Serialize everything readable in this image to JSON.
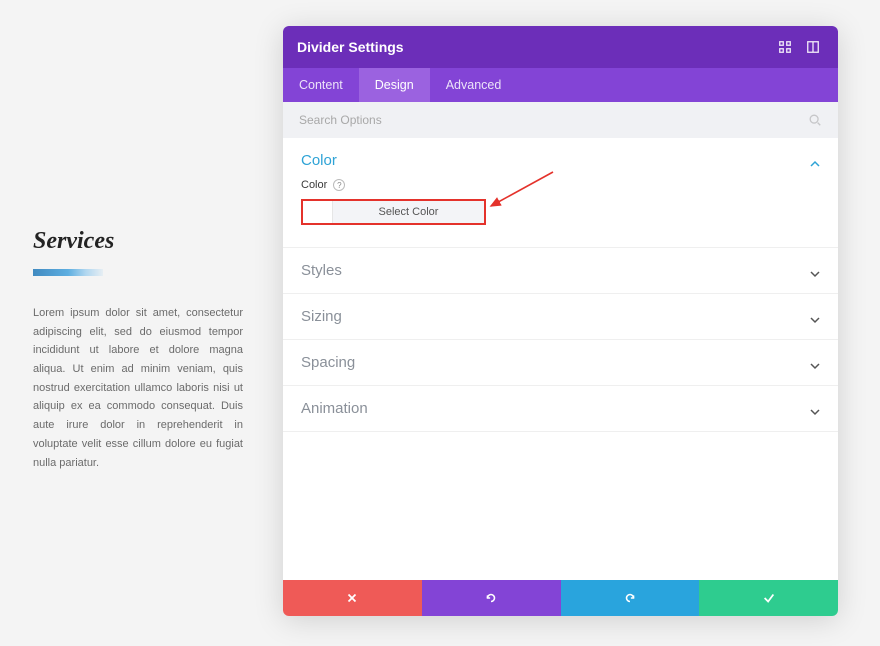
{
  "page": {
    "services_title": "Services",
    "services_text": "Lorem ipsum dolor sit amet, consectetur adipiscing elit, sed do eiusmod tempor incididunt ut labore et dolore magna aliqua. Ut enim ad minim veniam, quis nostrud exercitation ullamco laboris nisi ut aliquip ex ea commodo consequat. Duis aute irure dolor in reprehenderit in voluptate velit esse cillum dolore eu fugiat nulla pariatur."
  },
  "modal": {
    "title": "Divider Settings",
    "tabs": {
      "content": "Content",
      "design": "Design",
      "advanced": "Advanced"
    },
    "active_tab": "design",
    "search_placeholder": "Search Options",
    "sections": {
      "color": "Color",
      "styles": "Styles",
      "sizing": "Sizing",
      "spacing": "Spacing",
      "animation": "Animation"
    },
    "color_field": {
      "label": "Color",
      "help": "?",
      "button": "Select Color",
      "swatch_value": "#ffffff"
    },
    "footer": {
      "cancel": "cancel",
      "undo": "undo",
      "redo": "redo",
      "save": "save"
    },
    "colors": {
      "header_bg": "#6c2eb9",
      "tabs_bg": "#8344d6",
      "tab_active_bg": "#9b62e0",
      "accent_link": "#2ea3d6",
      "highlight_border": "#e4322b",
      "footer_red": "#ef5a57",
      "footer_purple": "#8344d6",
      "footer_blue": "#29a4dd",
      "footer_green": "#2ecc8f"
    }
  }
}
